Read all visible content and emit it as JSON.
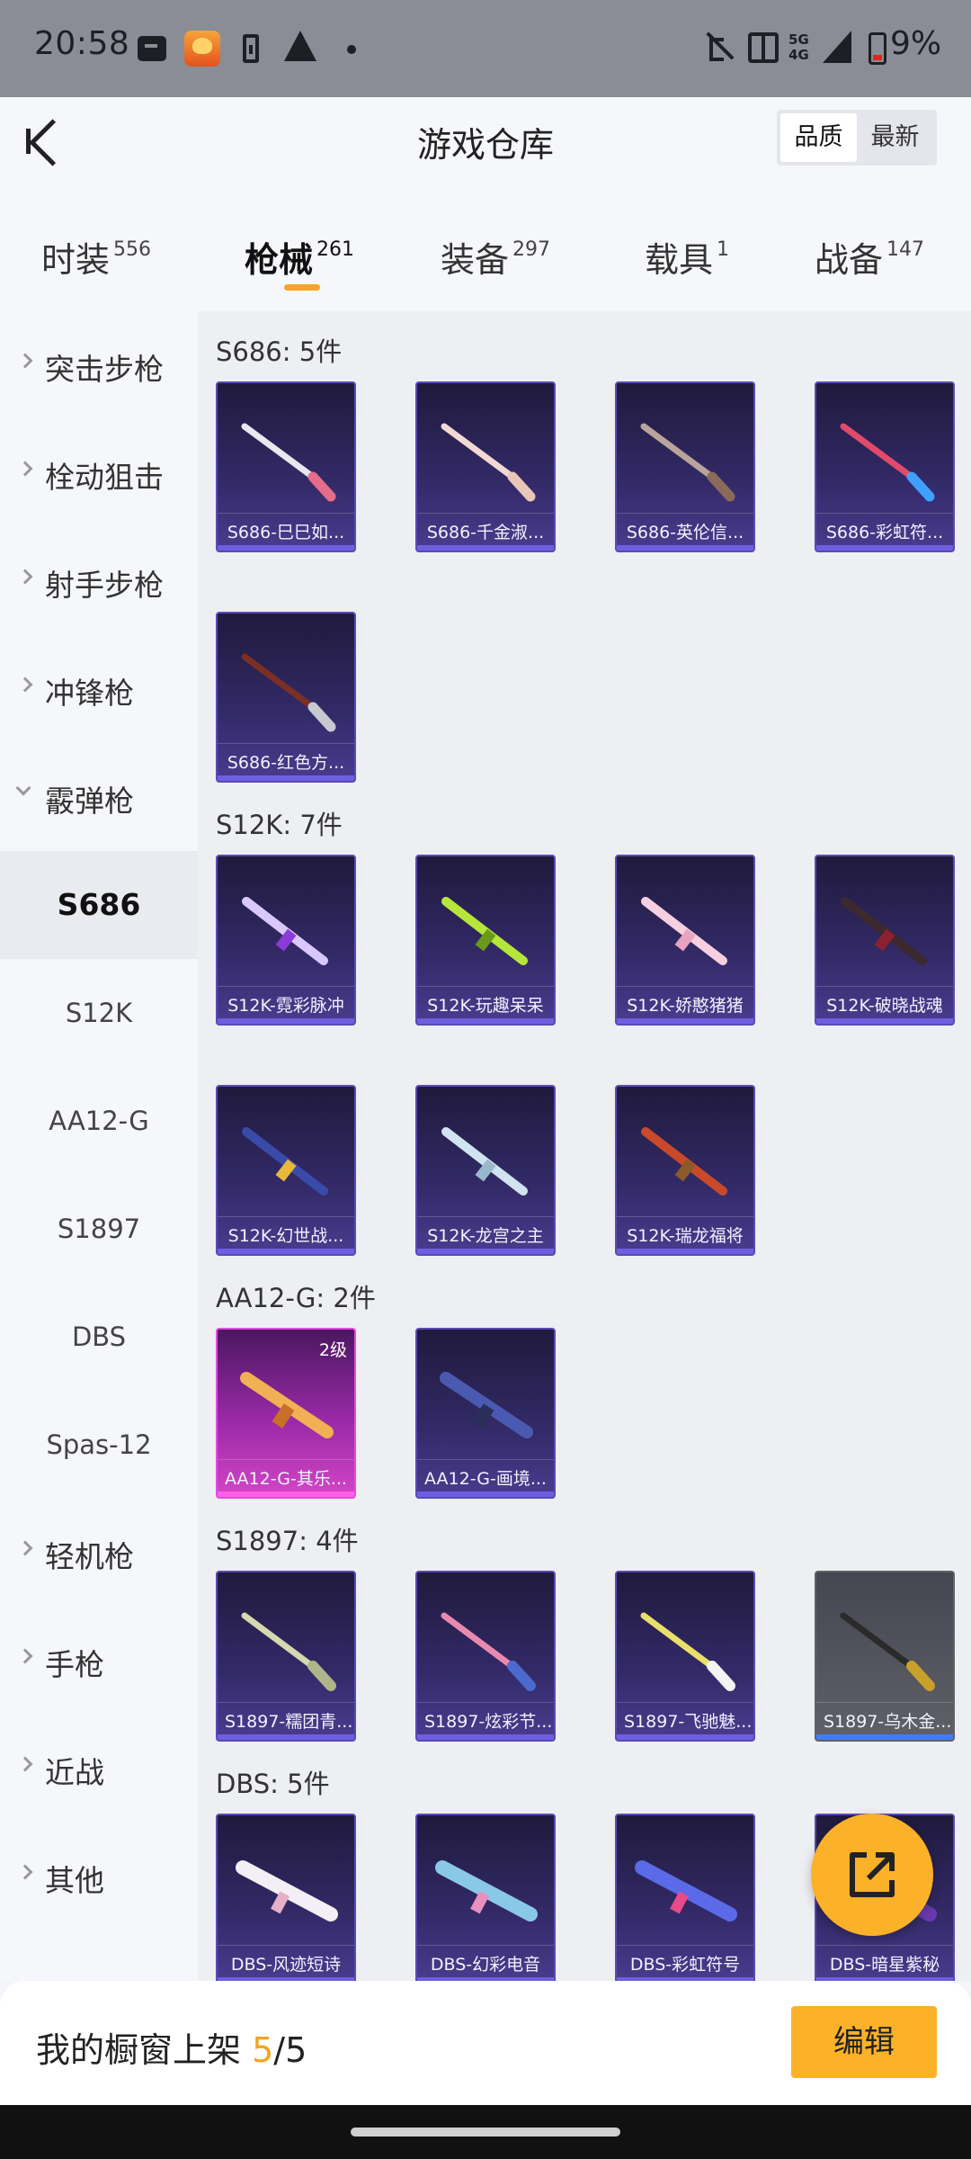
{
  "status_bar": {
    "time": "20:58",
    "network": "5G 4G",
    "battery": "9%"
  },
  "header": {
    "title": "游戏仓库",
    "sort": [
      "品质",
      "最新"
    ]
  },
  "tabs": [
    {
      "label": "时装",
      "count": "556"
    },
    {
      "label": "枪械",
      "count": "261"
    },
    {
      "label": "装备",
      "count": "297"
    },
    {
      "label": "载具",
      "count": "1"
    },
    {
      "label": "战备",
      "count": "147"
    }
  ],
  "sidebar": {
    "categories_top": [
      "突击步枪",
      "栓动狙击",
      "射手步枪",
      "冲锋枪",
      "霰弹枪"
    ],
    "subs": [
      "S686",
      "S12K",
      "AA12-G",
      "S1897",
      "DBS",
      "Spas-12"
    ],
    "categories_bottom": [
      "轻机枪",
      "手枪",
      "近战",
      "其他"
    ]
  },
  "sections": [
    {
      "title": "S686: 5件",
      "items": [
        "S686-巳巳如...",
        "S686-千金淑...",
        "S686-英伦信...",
        "S686-彩虹符...",
        "S686-红色方..."
      ]
    },
    {
      "title": "S12K: 7件",
      "items": [
        "S12K-霓彩脉冲",
        "S12K-玩趣呆呆",
        "S12K-娇憨猪猪",
        "S12K-破晓战魂",
        "S12K-幻世战...",
        "S12K-龙宫之主",
        "S12K-瑞龙福将"
      ]
    },
    {
      "title": "AA12-G: 2件",
      "items": [
        "AA12-G-其乐...",
        "AA12-G-画境..."
      ],
      "level": "2级"
    },
    {
      "title": "S1897: 4件",
      "items": [
        "S1897-糯团青...",
        "S1897-炫彩节...",
        "S1897-飞驰魅...",
        "S1897-乌木金..."
      ]
    },
    {
      "title": "DBS: 5件",
      "items": [
        "DBS-风迹短诗",
        "DBS-幻彩电音",
        "DBS-彩虹符号",
        "DBS-暗星紫秘"
      ]
    }
  ],
  "bottom": {
    "text": "我的橱窗上架 ",
    "current": "5",
    "total": "/5",
    "edit": "编辑"
  },
  "colors": {
    "accent": "#fbb128",
    "item_bg": "#332a68"
  }
}
